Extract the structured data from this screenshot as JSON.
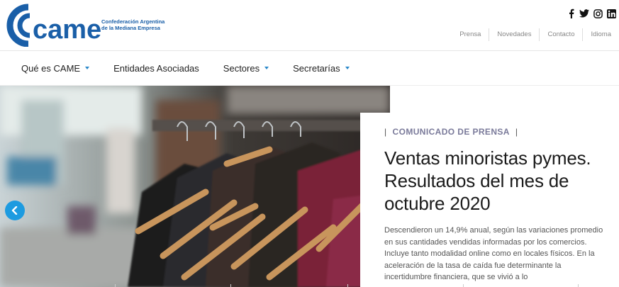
{
  "brand": {
    "logo_text": "came",
    "subtitle_line1": "Confederación Argentina",
    "subtitle_line2": "de la Mediana Empresa",
    "color": "#1a5fa8"
  },
  "social": [
    {
      "icon": "facebook-icon"
    },
    {
      "icon": "twitter-icon"
    },
    {
      "icon": "instagram-icon"
    },
    {
      "icon": "linkedin-icon"
    }
  ],
  "toplinks": [
    "Prensa",
    "Novedades",
    "Contacto",
    "Idioma"
  ],
  "nav": {
    "items": [
      {
        "label": "Qué es CAME",
        "dropdown": true
      },
      {
        "label": "Entidades Asociadas",
        "dropdown": false
      },
      {
        "label": "Sectores",
        "dropdown": true
      },
      {
        "label": "Secretarías",
        "dropdown": true
      }
    ],
    "accent": "#2a88c9"
  },
  "hero": {
    "kicker": "COMUNICADO DE PRENSA",
    "headline": "Ventas minoristas pymes. Resultados del mes de octubre 2020",
    "excerpt": "Descendieron un 14,9% anual, según las variaciones promedio en sus cantidades vendidas informadas por los comercios. Incluye tanto modalidad online como en locales físicos. En la aceleración de la tasa de caída fue determinante la incertidumbre financiera, que se vivió a lo",
    "prev_icon": "chevron-left-icon",
    "arrow_color": "#1d9be0"
  }
}
